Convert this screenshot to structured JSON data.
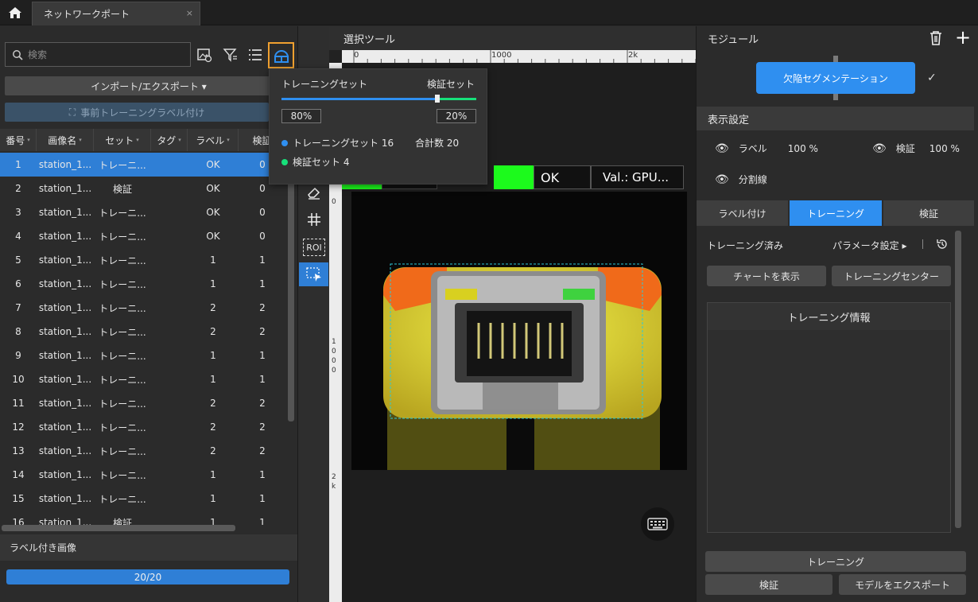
{
  "topbar": {
    "tab_title": "ネットワークポート",
    "close": "×"
  },
  "left": {
    "search_placeholder": "検索",
    "import_label": "インポート/エクスポート ▾",
    "pretrain_label": "事前トレーニングラベル付け",
    "columns": [
      "番号",
      "画像名",
      "セット",
      "タグ",
      "ラベル",
      "検証"
    ],
    "rows": [
      {
        "no": "1",
        "name": "station_1...",
        "set": "トレーニ...",
        "tag": "",
        "label": "OK",
        "val": "0",
        "selected": true
      },
      {
        "no": "2",
        "name": "station_1...",
        "set": "検証",
        "tag": "",
        "label": "OK",
        "val": "0"
      },
      {
        "no": "3",
        "name": "station_1...",
        "set": "トレーニ...",
        "tag": "",
        "label": "OK",
        "val": "0"
      },
      {
        "no": "4",
        "name": "station_1...",
        "set": "トレーニ...",
        "tag": "",
        "label": "OK",
        "val": "0"
      },
      {
        "no": "5",
        "name": "station_1...",
        "set": "トレーニ...",
        "tag": "",
        "label": "1",
        "val": "1"
      },
      {
        "no": "6",
        "name": "station_1...",
        "set": "トレーニ...",
        "tag": "",
        "label": "1",
        "val": "1"
      },
      {
        "no": "7",
        "name": "station_1...",
        "set": "トレーニ...",
        "tag": "",
        "label": "2",
        "val": "2"
      },
      {
        "no": "8",
        "name": "station_1...",
        "set": "トレーニ...",
        "tag": "",
        "label": "2",
        "val": "2"
      },
      {
        "no": "9",
        "name": "station_1...",
        "set": "トレーニ...",
        "tag": "",
        "label": "1",
        "val": "1"
      },
      {
        "no": "10",
        "name": "station_1...",
        "set": "トレーニ...",
        "tag": "",
        "label": "1",
        "val": "1"
      },
      {
        "no": "11",
        "name": "station_1...",
        "set": "トレーニ...",
        "tag": "",
        "label": "2",
        "val": "2"
      },
      {
        "no": "12",
        "name": "station_1...",
        "set": "トレーニ...",
        "tag": "",
        "label": "2",
        "val": "2"
      },
      {
        "no": "13",
        "name": "station_1...",
        "set": "トレーニ...",
        "tag": "",
        "label": "2",
        "val": "2"
      },
      {
        "no": "14",
        "name": "station_1...",
        "set": "トレーニ...",
        "tag": "",
        "label": "1",
        "val": "1"
      },
      {
        "no": "15",
        "name": "station_1...",
        "set": "トレーニ...",
        "tag": "",
        "label": "1",
        "val": "1"
      },
      {
        "no": "16",
        "name": "station_1...",
        "set": "検証",
        "tag": "",
        "label": "1",
        "val": "1"
      }
    ],
    "labeled_header": "ラベル付き画像",
    "labeled_progress": "20/20",
    "labeled_fraction": 1.0
  },
  "popup": {
    "train_title": "トレーニングセット",
    "val_title": "検証セット",
    "train_pct": "80%",
    "val_pct": "20%",
    "split_fraction": 0.8,
    "train_count_label": "トレーニングセット 16",
    "total_label": "合計数 20",
    "val_count_label": "検証セット 4",
    "train_color": "#2f8ff0",
    "val_color": "#17e07a"
  },
  "center": {
    "title": "選択ツール",
    "ruler_marks": [
      "0",
      "1000",
      "2k"
    ],
    "ruler_left_marks": [
      "0",
      "1000",
      "2k"
    ],
    "roi_label": "ROI",
    "result_label": "OK",
    "val_label": "Val.: GPU..."
  },
  "right": {
    "module_title": "モジュール",
    "module_name": "欠陥セグメンテーション",
    "display_title": "表示設定",
    "label_toggle": "ラベル",
    "label_pct": "100 %",
    "val_toggle": "検証",
    "val_pct": "100 %",
    "split_toggle": "分割線",
    "tabs": [
      "ラベル付け",
      "トレーニング",
      "検証"
    ],
    "trained_label": "トレーニング済み",
    "param_label": "パラメータ設定 ▸",
    "show_chart": "チャートを表示",
    "train_center": "トレーニングセンター",
    "train_info": "トレーニング情報",
    "train_button": "トレーニング",
    "validate_button": "検証",
    "export_button": "モデルをエクスポート",
    "accent": "#2f8ff0"
  }
}
